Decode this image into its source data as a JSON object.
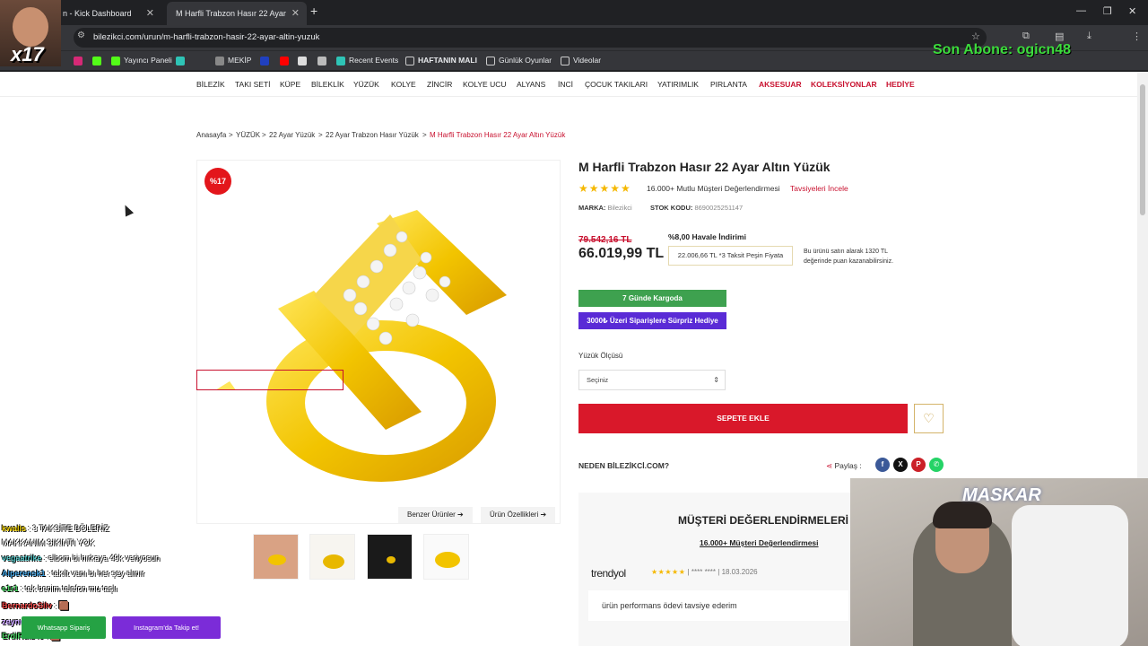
{
  "browser": {
    "tabs": [
      {
        "label": "n - Kick Dashboard"
      },
      {
        "label": "M Harfli Trabzon Hasır 22 Ayar"
      }
    ],
    "url": "bilezikci.com/urun/m-harfli-trabzon-hasir-22-ayar-altin-yuzuk",
    "bookmarks": [
      "Yayıncı Paneli",
      "MEKİP",
      "Recent Events",
      "HAFTANIN MALI",
      "Günlük Oyunlar",
      "Videolar"
    ]
  },
  "overlay": {
    "sub_text": "Son Abone: ogicn48",
    "cam_label": "x17",
    "webcam_logo": "MASKAR"
  },
  "nav": {
    "items": [
      "BİLEZİK",
      "TAKI SETİ",
      "KÜPE",
      "BİLEKLİK",
      "YÜZÜK",
      "KOLYE",
      "ZİNCİR",
      "KOLYE UCU",
      "ALYANS",
      "İNCİ",
      "ÇOCUK TAKILARI",
      "YATIRIMLIK",
      "PIRLANTA"
    ],
    "highlight": [
      "AKSESUAR",
      "KOLEKSİYONLAR",
      "HEDİYE"
    ]
  },
  "breadcrumb": {
    "items": [
      "Anasayfa",
      "YÜZÜK",
      "22 Ayar Yüzük",
      "22 Ayar Trabzon Hasır Yüzük"
    ],
    "current": "M Harfli Trabzon Hasır 22 Ayar Altın Yüzük",
    "sep": ">"
  },
  "product": {
    "badge": "%17",
    "title": "M Harfli Trabzon Hasır 22 Ayar Altın Yüzük",
    "rating_text": "16.000+ Mutlu Müşteri Değerlendirmesi",
    "review_link": "Tavsiyeleri İncele",
    "brand_label": "MARKA:",
    "brand": "Bilezikci",
    "sku_label": "STOK KODU:",
    "sku": "8690025251147",
    "old_price": "79.542,16 TL",
    "price": "66.019,99 TL",
    "havale": "%8,00 Havale İndirimi",
    "taksit": "22.006,66 TL *3 Taksit Peşin Fiyata",
    "puan_line1": "Bu ürünü satın alarak 1320 TL",
    "puan_line2": "değerinde puan kazanabilirsiniz.",
    "kargo": "7 Günde Kargoda",
    "hediye": "3000₺ Üzeri Siparişlere Sürpriz Hediye",
    "size_label": "Yüzük Ölçüsü",
    "size_value": "Seçiniz",
    "add_to_cart": "SEPETE EKLE",
    "why": "NEDEN BİLEZİKCİ.COM?",
    "share": "Paylaş :",
    "similar_btn": "Benzer Ürünler",
    "features_btn": "Ürün Özellikleri"
  },
  "reviews": {
    "title": "MÜŞTERİ DEĞERLENDİRMELERİ",
    "subtitle": "16.000+ Müşteri Değerlendirmesi",
    "source": "trendyol",
    "stars": "★★★★★",
    "user": "**** ****",
    "date": "18.03.2026",
    "text": "ürün performans ödevi tavsiye ederim"
  },
  "chat": {
    "lines": [
      {
        "user": "kwalis",
        "msg": " : 3 TAKSİTE BÖLERİZ",
        "color": "#f0d000"
      },
      {
        "user": "",
        "msg": "MAKKANIM SIKINTI YOK",
        "color": "#ffffff"
      },
      {
        "user": "vegaatrike",
        "msg": " : elbom bi hırkaya 49k veriyosun",
        "color": "#4fc1c1"
      },
      {
        "user": "Alperensk1",
        "msg": " : takılt vanı bı her şey alınır",
        "color": "#3a9ad9"
      },
      {
        "user": "e1r1",
        "msg": " : tek benim telefon mu taşlı",
        "color": "#46d160"
      },
      {
        "user": "BernardoSilv",
        "msg": " : 🟫",
        "color": "#e84040"
      },
      {
        "user": "zeynuhammed",
        "msg": " : 🟫",
        "color": "#c8a0ff"
      },
      {
        "user": "ErdiRulz45",
        "msg": " : 🟫",
        "color": "#46d160"
      }
    ],
    "whatsapp": "Whatsapp Sipariş",
    "instagram": "Instagram'da Takip et!"
  }
}
